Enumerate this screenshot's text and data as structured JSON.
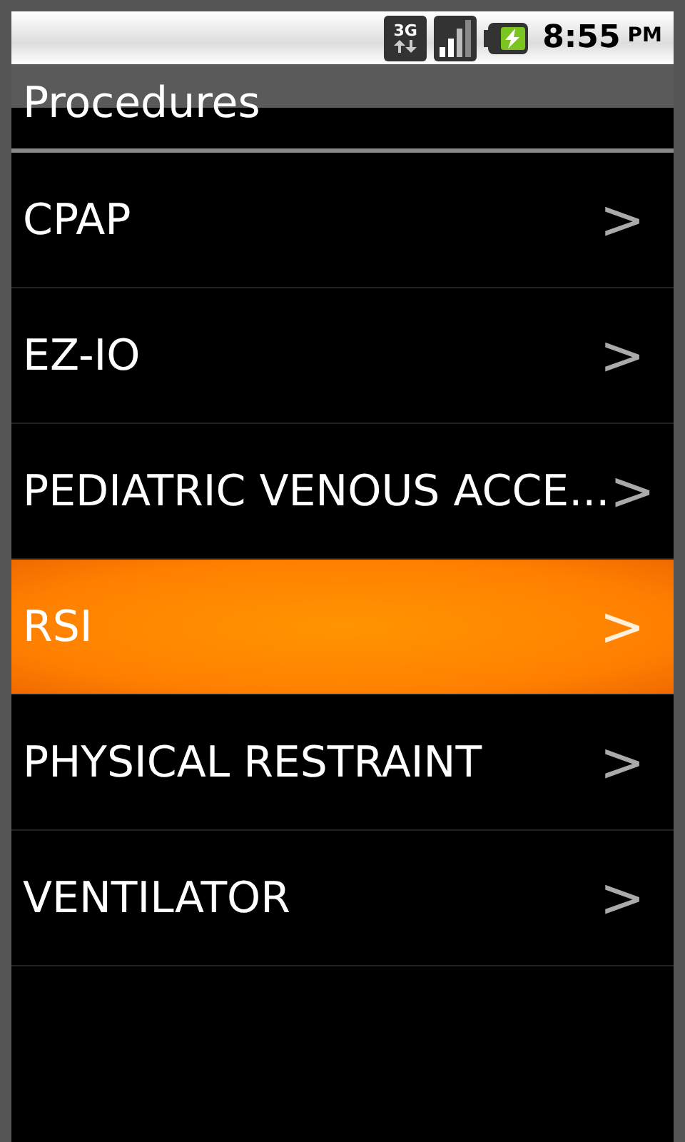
{
  "status_bar": {
    "network": "3G",
    "time": "8:55",
    "ampm": "PM"
  },
  "title": "Procedures",
  "items": [
    {
      "label": "CPAP",
      "arrow": ">",
      "selected": false
    },
    {
      "label": "EZ-IO",
      "arrow": ">",
      "selected": false
    },
    {
      "label": "PEDIATRIC VENOUS ACCE...",
      "arrow": ">",
      "selected": false
    },
    {
      "label": "RSI",
      "arrow": ">",
      "selected": true
    },
    {
      "label": "PHYSICAL RESTRAINT",
      "arrow": ">",
      "selected": false
    },
    {
      "label": "VENTILATOR",
      "arrow": ">",
      "selected": false
    }
  ]
}
